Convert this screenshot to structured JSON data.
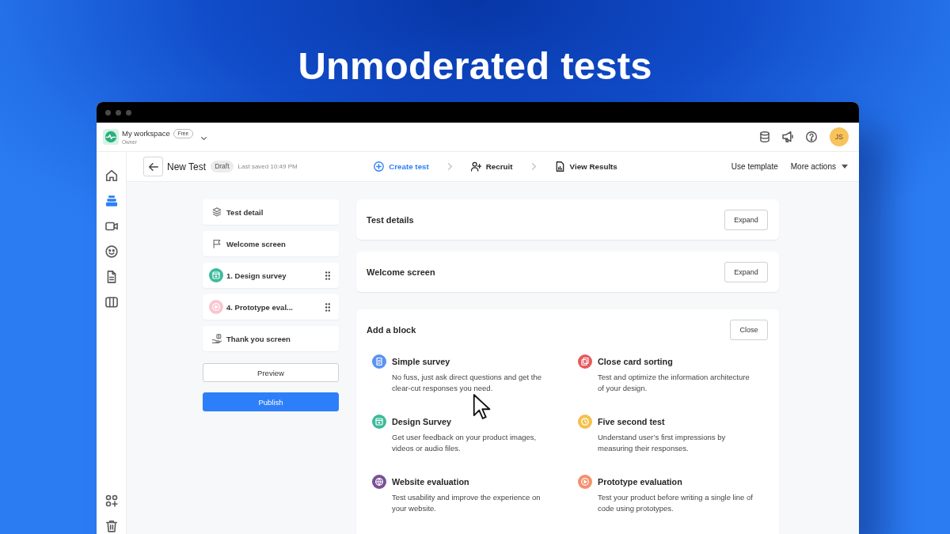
{
  "headline": "Unmoderated tests",
  "app": {
    "header": {
      "workspace": "My workspace",
      "plan": "Free",
      "role": "Owner",
      "avatar": "JS"
    },
    "nav_rail": [
      {
        "selected": false
      },
      {
        "selected": true
      },
      {
        "selected": false
      },
      {
        "selected": false
      },
      {
        "selected": false
      },
      {
        "selected": false
      }
    ],
    "toolbar": {
      "title": "New Test",
      "status": "Draft",
      "saved": "Last saved 10:49 PM",
      "steps": [
        {
          "kind": "create",
          "label": "Create test",
          "selected": true
        },
        {
          "kind": "recruit",
          "label": "Recruit",
          "selected": false
        },
        {
          "kind": "results",
          "label": "View Results",
          "selected": false
        }
      ],
      "actions": [
        {
          "kind": "link",
          "label": "Use template"
        },
        {
          "kind": "menu",
          "label": "More actions"
        }
      ]
    },
    "outline": {
      "items": [
        {
          "kind": "details",
          "label": "Test detail"
        },
        {
          "kind": "welcome",
          "label": "Welcome screen"
        },
        {
          "kind": "design",
          "label": "1. Design survey",
          "color": "#3dbb9c"
        },
        {
          "kind": "prototype",
          "label": "4. Prototype eval...",
          "color": "#f9c6cf"
        },
        {
          "kind": "thanks",
          "label": "Thank you screen"
        }
      ],
      "buttons": [
        {
          "kind": "preview",
          "label": "Preview"
        },
        {
          "kind": "publish",
          "label": "Publish"
        }
      ]
    },
    "sections": [
      {
        "title": "Test details",
        "action": "Expand"
      },
      {
        "title": "Welcome screen",
        "action": "Expand"
      }
    ],
    "add_block": {
      "title": "Add a block",
      "action": "Close",
      "blocks": [
        {
          "kind": "survey",
          "title": "Simple survey",
          "description": "No fuss, just ask direct questions and get the clear-cut responses you need.",
          "color": "#5b92f4"
        },
        {
          "kind": "cards",
          "title": "Close card sorting",
          "description": "Test and optimize the information architecture of your design.",
          "color": "#e85a5c"
        },
        {
          "kind": "design",
          "title": "Design Survey",
          "description": "Get user feedback on your product images, videos or audio files.",
          "color": "#3dbb9c"
        },
        {
          "kind": "timer",
          "title": "Five second test",
          "description": "Understand user’s first impressions by measuring their responses.",
          "color": "#f6c04c"
        },
        {
          "kind": "website",
          "title": "Website evaluation",
          "description": "Test usability and improve the experience on your website.",
          "color": "#7a5096"
        },
        {
          "kind": "prototype",
          "title": "Prototype evaluation",
          "description": "Test your product before writing a single line of code using prototypes.",
          "color": "#f78f6b"
        }
      ]
    }
  }
}
